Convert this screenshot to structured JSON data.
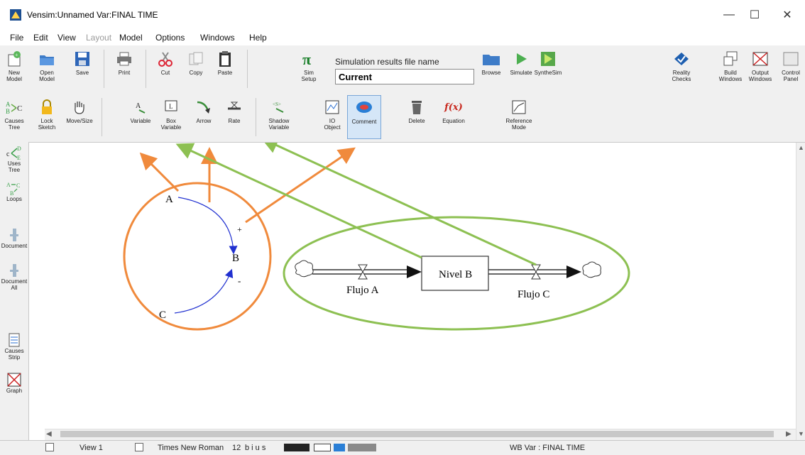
{
  "window": {
    "title": "Vensim:Unnamed Var:FINAL TIME",
    "minimize": "—",
    "maximize": "☐",
    "close": "✕"
  },
  "menu": [
    "File",
    "Edit",
    "View",
    "Layout",
    "Model",
    "Options",
    "Windows",
    "Help"
  ],
  "toolbar1": {
    "new_model": "New\nModel",
    "open_model": "Open\nModel",
    "save": "Save",
    "print": "Print",
    "cut": "Cut",
    "copy": "Copy",
    "paste": "Paste",
    "sim_setup": "Sim\nSetup",
    "simfile_label": "Simulation results file name",
    "simfile_value": "Current",
    "browse": "Browse",
    "simulate": "Simulate",
    "synthesim": "SyntheSim",
    "reality_checks": "Reality\nChecks",
    "build_windows": "Build\nWindows",
    "output_windows": "Output\nWindows",
    "control_panel": "Control\nPanel"
  },
  "toolbar2": {
    "causes_tree": "Causes\nTree",
    "lock_sketch": "Lock\nSketch",
    "move_size": "Move/Size",
    "variable": "Variable",
    "box_variable": "Box\nVariable",
    "arrow": "Arrow",
    "rate": "Rate",
    "shadow_variable": "Shadow\nVariable",
    "io_object": "IO\nObject",
    "comment": "Comment",
    "delete": "Delete",
    "equation": "Equation",
    "reference_mode": "Reference\nMode",
    "shadow_badge": "<S>",
    "fx_glyph": "f(x)"
  },
  "lefttool": [
    {
      "name": "causes-tree-left",
      "label": "Causes\nTree"
    },
    {
      "name": "uses-tree",
      "label": "Uses\nTree"
    },
    {
      "name": "loops",
      "label": "Loops"
    },
    {
      "name": "document",
      "label": "Document"
    },
    {
      "name": "document-all",
      "label": "Document\nAll"
    },
    {
      "name": "causes-strip",
      "label": "Causes\nStrip"
    },
    {
      "name": "graph",
      "label": "Graph"
    }
  ],
  "diagram": {
    "var_a": "A",
    "var_b": "B",
    "var_c": "C",
    "pol_plus": "+",
    "pol_minus": "-",
    "stock": "Nivel B",
    "flow_a": "Flujo A",
    "flow_c": "Flujo C"
  },
  "statusbar": {
    "view": "View 1",
    "font": "Times New Roman",
    "size": "12",
    "fmt": "b i u s",
    "wb_var": "WB Var : FINAL TIME"
  },
  "colors": {
    "orange": "#f08a3c",
    "green": "#8dc052",
    "link_blue": "#2030d0"
  }
}
